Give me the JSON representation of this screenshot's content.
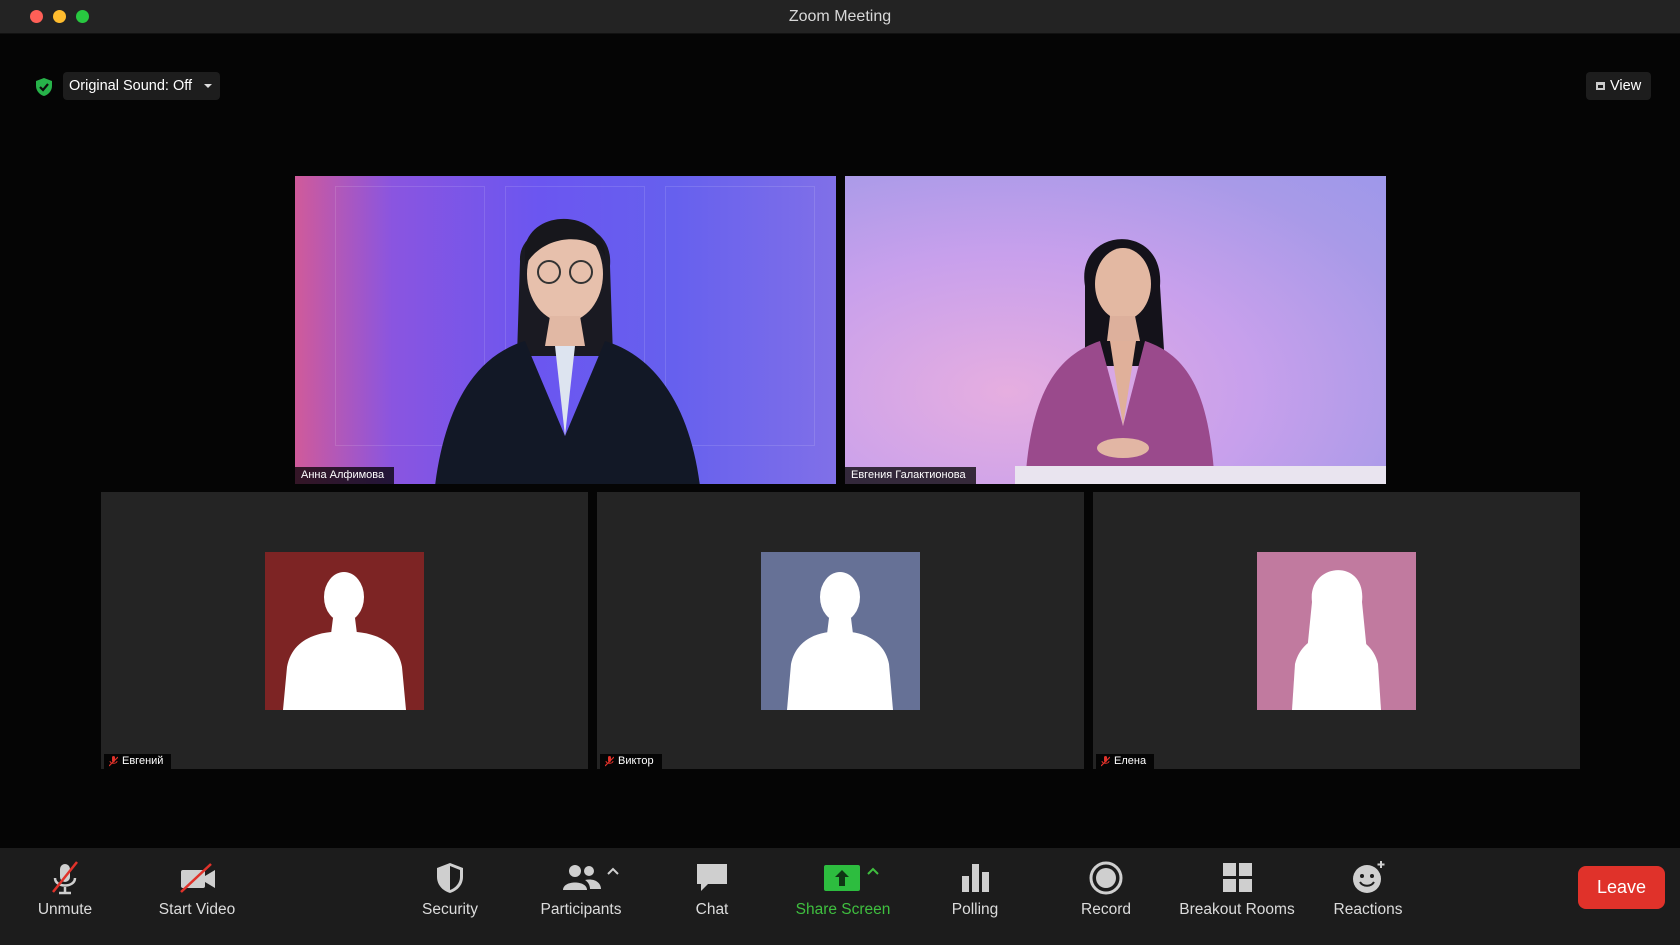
{
  "window": {
    "title": "Zoom Meeting"
  },
  "top_controls": {
    "original_sound": "Original Sound: Off",
    "view": "View"
  },
  "participants": {
    "video": [
      {
        "name": "Анна Алфимова"
      },
      {
        "name": "Евгения Галактионова"
      }
    ],
    "avatars": [
      {
        "name": "Евгений",
        "bg": "#7d2424",
        "muted": true
      },
      {
        "name": "Виктор",
        "bg": "#667196",
        "muted": true
      },
      {
        "name": "Елена",
        "bg": "#c17a9f",
        "muted": true
      }
    ]
  },
  "toolbar": {
    "unmute": "Unmute",
    "start_video": "Start Video",
    "security": "Security",
    "participants": "Participants",
    "chat": "Chat",
    "share_screen": "Share Screen",
    "polling": "Polling",
    "record": "Record",
    "breakout_rooms": "Breakout Rooms",
    "reactions": "Reactions",
    "leave": "Leave"
  },
  "colors": {
    "accent_green": "#3fbf3f",
    "leave_red": "#e0322a",
    "muted_red": "#e0322a"
  }
}
